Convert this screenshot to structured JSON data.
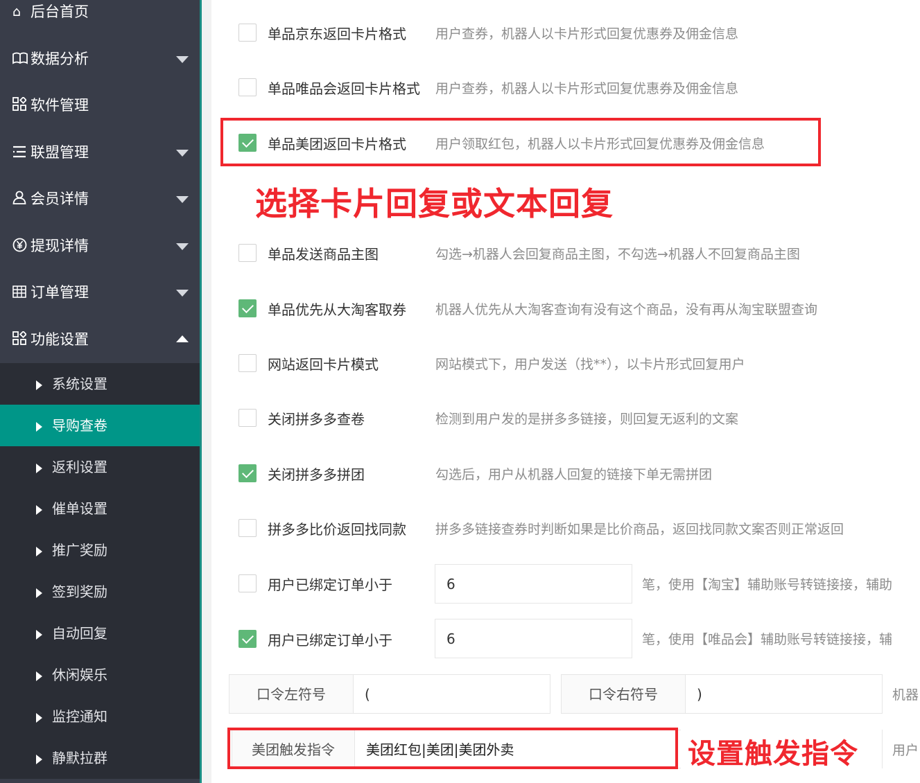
{
  "sidebar": {
    "items": [
      {
        "label": "后台首页",
        "icon": "home-icon",
        "glyph": "⌂",
        "has_caret": false
      },
      {
        "label": "数据分析",
        "icon": "book-icon",
        "glyph": "📖",
        "has_caret": true
      },
      {
        "label": "软件管理",
        "icon": "apps-icon",
        "glyph": "▦",
        "has_caret": false
      },
      {
        "label": "联盟管理",
        "icon": "list-icon",
        "glyph": "☰",
        "has_caret": true
      },
      {
        "label": "会员详情",
        "icon": "user-icon",
        "glyph": "⚇",
        "has_caret": true
      },
      {
        "label": "提现详情",
        "icon": "yen-icon",
        "glyph": "¥",
        "has_caret": true
      },
      {
        "label": "订单管理",
        "icon": "grid-icon",
        "glyph": "▤",
        "has_caret": true
      },
      {
        "label": "功能设置",
        "icon": "apps-icon",
        "glyph": "▦",
        "has_caret": true,
        "expanded": true
      }
    ],
    "subitems": [
      {
        "label": "系统设置",
        "active": false
      },
      {
        "label": "导购查卷",
        "active": true
      },
      {
        "label": "返利设置",
        "active": false
      },
      {
        "label": "催单设置",
        "active": false
      },
      {
        "label": "推广奖励",
        "active": false
      },
      {
        "label": "签到奖励",
        "active": false
      },
      {
        "label": "自动回复",
        "active": false
      },
      {
        "label": "休闲娱乐",
        "active": false
      },
      {
        "label": "监控通知",
        "active": false
      },
      {
        "label": "静默拉群",
        "active": false
      }
    ]
  },
  "options": [
    {
      "label": "单品京东返回卡片格式",
      "checked": false,
      "desc": "用户查券，机器人以卡片形式回复优惠券及佣金信息"
    },
    {
      "label": "单品唯品会返回卡片格式",
      "checked": false,
      "desc": "用户查券，机器人以卡片形式回复优惠券及佣金信息"
    },
    {
      "label": "单品美团返回卡片格式",
      "checked": true,
      "desc": "用户领取红包，机器人以卡片形式回复优惠券及佣金信息"
    },
    {
      "label": "单品发送商品主图",
      "checked": false,
      "desc": "勾选→机器人会回复商品主图，不勾选→机器人不回复商品主图"
    },
    {
      "label": "单品优先从大淘客取券",
      "checked": true,
      "desc": "机器人优先从大淘客查询有没有这个商品，没有再从淘宝联盟查询"
    },
    {
      "label": "网站返回卡片模式",
      "checked": false,
      "desc": "网站模式下，用户发送（找**），以卡片形式回复用户"
    },
    {
      "label": "关闭拼多多查卷",
      "checked": false,
      "desc": "检测到用户发的是拼多多链接，则回复无返利的文案"
    },
    {
      "label": "关闭拼多多拼团",
      "checked": true,
      "desc": "勾选后，用户从机器人回复的链接下单无需拼团"
    },
    {
      "label": "拼多多比价返回找同款",
      "checked": false,
      "desc": "拼多多链接查券时判断如果是比价商品，返回找同款文案否则正常返回"
    }
  ],
  "order_rows": [
    {
      "label": "用户已绑定订单小于",
      "checked": false,
      "value": "6",
      "desc": "笔，使用【淘宝】辅助账号转链接接，辅助"
    },
    {
      "label": "用户已绑定订单小于",
      "checked": true,
      "value": "6",
      "desc": "笔，使用【唯品会】辅助账号转链接接，辅"
    }
  ],
  "password_symbols": {
    "left_label": "口令左符号",
    "left_value": "(",
    "right_label": "口令右符号",
    "right_value": ")",
    "tail": "机器"
  },
  "meituan": {
    "label": "美团触发指令",
    "value": "美团红包|美团|美团外卖",
    "tail": "用户"
  },
  "annotations": {
    "callout1": "选择卡片回复或文本回复",
    "callout2": "设置触发指令"
  },
  "colors": {
    "sidebar_bg": "#393d49",
    "submenu_bg": "#2a2d35",
    "active_bg": "#009688",
    "check_green": "#5fb878",
    "annotation_red": "#f0272e"
  }
}
